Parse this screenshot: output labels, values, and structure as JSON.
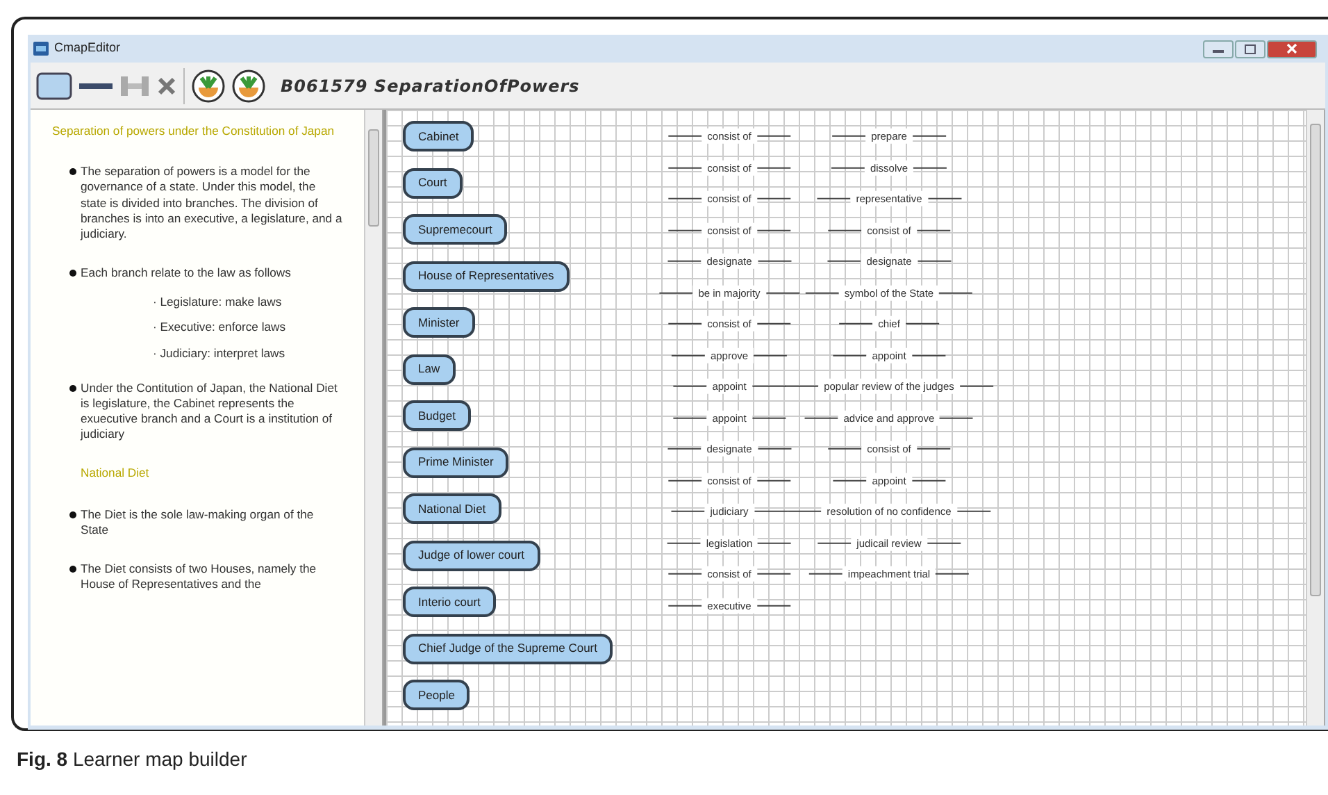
{
  "window": {
    "title": "CmapEditor",
    "map_title": "B061579 SeparationOfPowers"
  },
  "text_panel": [
    {
      "kind": "heading",
      "text": "Separation of powers under the Constitution of Japan"
    },
    {
      "kind": "bullet",
      "text": "The separation of powers is a model for the governance of a state. Under this model, the state is divided into branches. The division of branches is into an executive, a legislature, and a judiciary."
    },
    {
      "kind": "bullet",
      "text": "Each branch relate to the law as follows"
    },
    {
      "kind": "sub",
      "text": "· Legislature: make laws"
    },
    {
      "kind": "sub",
      "text": "· Executive: enforce laws"
    },
    {
      "kind": "sub",
      "text": "· Judiciary: interpret laws"
    },
    {
      "kind": "bullet",
      "text": "Under the Contitution of Japan, the National Diet is legislature, the Cabinet represents the exuecutive branch and a Court is a institution of judiciary"
    },
    {
      "kind": "heading2",
      "text": "National Diet"
    },
    {
      "kind": "bullet",
      "text": "The Diet is the sole law-making organ of the State"
    },
    {
      "kind": "bullet",
      "text": "The Diet consists of two Houses, namely the House of Representatives and the"
    }
  ],
  "concepts": [
    "Cabinet",
    "Court",
    "Supremecourt",
    "House of Representatives",
    "Minister",
    "Law",
    "Budget",
    "Prime Minister",
    "National Diet",
    "Judge of lower court",
    "Interio court",
    "Chief Judge of the Supreme Court",
    "People"
  ],
  "link_columns": [
    [
      "consist of",
      "consist of",
      "consist of",
      "consist of",
      "designate",
      "be in majority",
      "consist of",
      "approve",
      "appoint",
      "appoint",
      "designate",
      "consist of",
      "judiciary",
      "legislation",
      "consist of",
      "executive"
    ],
    [
      "prepare",
      "dissolve",
      "representative",
      "consist of",
      "designate",
      "symbol of the State",
      "chief",
      "appoint",
      "popular review of the judges",
      "advice and approve",
      "consist of",
      "appoint",
      "resolution of no confidence",
      "judicail review",
      "impeachment trial"
    ]
  ],
  "caption": "**Fig. 8** Learner map builder"
}
